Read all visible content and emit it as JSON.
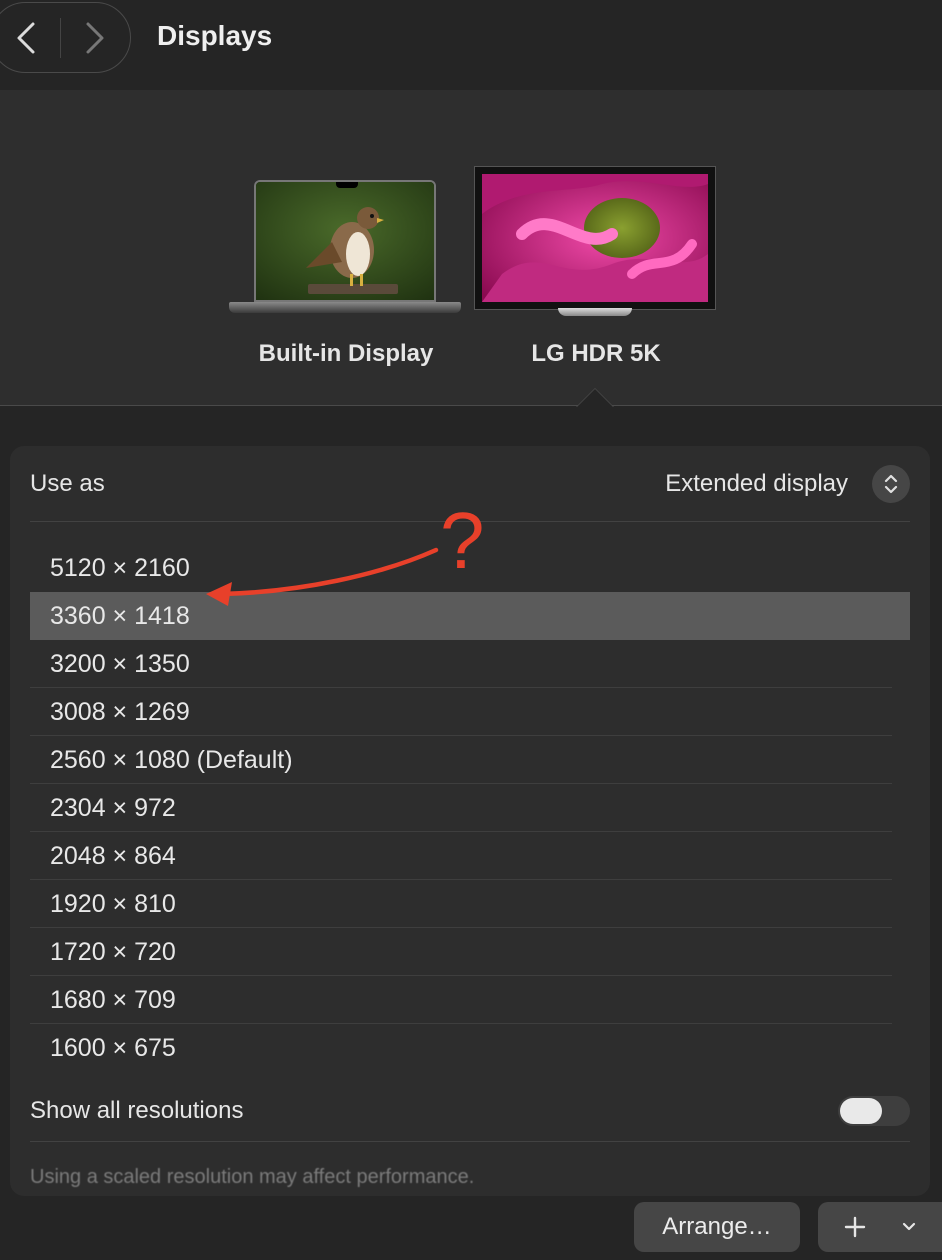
{
  "header": {
    "title": "Displays"
  },
  "displays": [
    {
      "name": "Built-in Display",
      "type": "laptop",
      "selected": false
    },
    {
      "name": "LG HDR 5K",
      "type": "monitor",
      "selected": true
    }
  ],
  "use_as": {
    "label": "Use as",
    "value": "Extended display"
  },
  "resolutions": {
    "items": [
      "5120 × 2160",
      "3360 × 1418",
      "3200 × 1350",
      "3008 × 1269",
      "2560 × 1080 (Default)",
      "2304 × 972",
      "2048 × 864",
      "1920 × 810",
      "1720 × 720",
      "1680 × 709",
      "1600 × 675"
    ],
    "selected": "3360 × 1418"
  },
  "show_all": {
    "label": "Show all resolutions",
    "enabled": false
  },
  "hint": "Using a scaled resolution may affect performance.",
  "footer": {
    "arrange_label": "Arrange…"
  },
  "annotation": {
    "mark": "?",
    "color": "#e8402a"
  },
  "colors": {
    "background": "#252525",
    "panel": "#2d2d2d",
    "selected_row": "#5b5b5b"
  }
}
